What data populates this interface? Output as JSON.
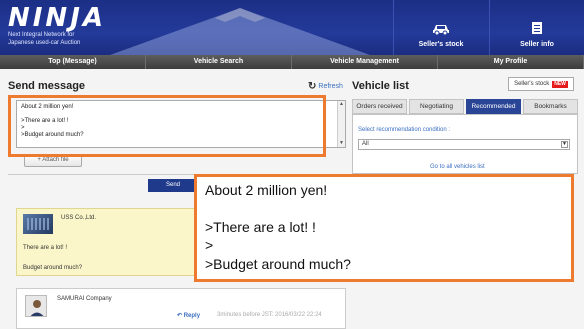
{
  "header": {
    "logo": "NINJA",
    "logo_tagline_1": "Next Integral Network for",
    "logo_tagline_2": "Japanese used-car Auction",
    "sellers_stock": "Seller's stock",
    "seller_info": "Seller info"
  },
  "nav": {
    "items": [
      {
        "label": "Top (Message)"
      },
      {
        "label": "Vehicle Search"
      },
      {
        "label": "Vehicle Management"
      },
      {
        "label": "My Profile"
      }
    ]
  },
  "send_panel": {
    "title": "Send message",
    "refresh_label": "Refresh",
    "message_lines": [
      "About 2 million yen!",
      "",
      ">There are a lot! !",
      ">",
      ">Budget around much?"
    ],
    "attach_label": "+ Attach file",
    "send_label": "Send"
  },
  "messages": [
    {
      "company": "USS Co.,Ltd.",
      "lines": [
        "There are a lot! !",
        "Budget around much?"
      ]
    },
    {
      "company": "SAMURAI Company",
      "reply_label": "Reply",
      "meta": "3minutes before JST: 2016/03/22 22:24"
    }
  ],
  "vehicle_list": {
    "title": "Vehicle list",
    "stock_button": "Seller's stock",
    "new_badge": "NEW",
    "tabs": [
      {
        "label": "Orders received",
        "active": false
      },
      {
        "label": "Negotiating",
        "active": false
      },
      {
        "label": "Recommended",
        "active": true
      },
      {
        "label": "Bookmarks",
        "active": false
      }
    ],
    "condition_label": "Select recommendation condition :",
    "condition_value": "All",
    "go_link": "Go to all vehicles list"
  },
  "zoom_lines": [
    "About 2 million yen!",
    "",
    ">There are a lot! !",
    ">",
    ">Budget around much?"
  ],
  "colors": {
    "header_blue": "#243a9a",
    "highlight_orange": "#ee7a2f",
    "active_tab": "#2a4596",
    "new_badge": "#e41c1c",
    "card_yellow": "#fbf6c9"
  },
  "icons": {
    "car": "car-icon",
    "info": "document-icon",
    "refresh": "refresh-icon",
    "reply": "reply-arrow-icon"
  }
}
